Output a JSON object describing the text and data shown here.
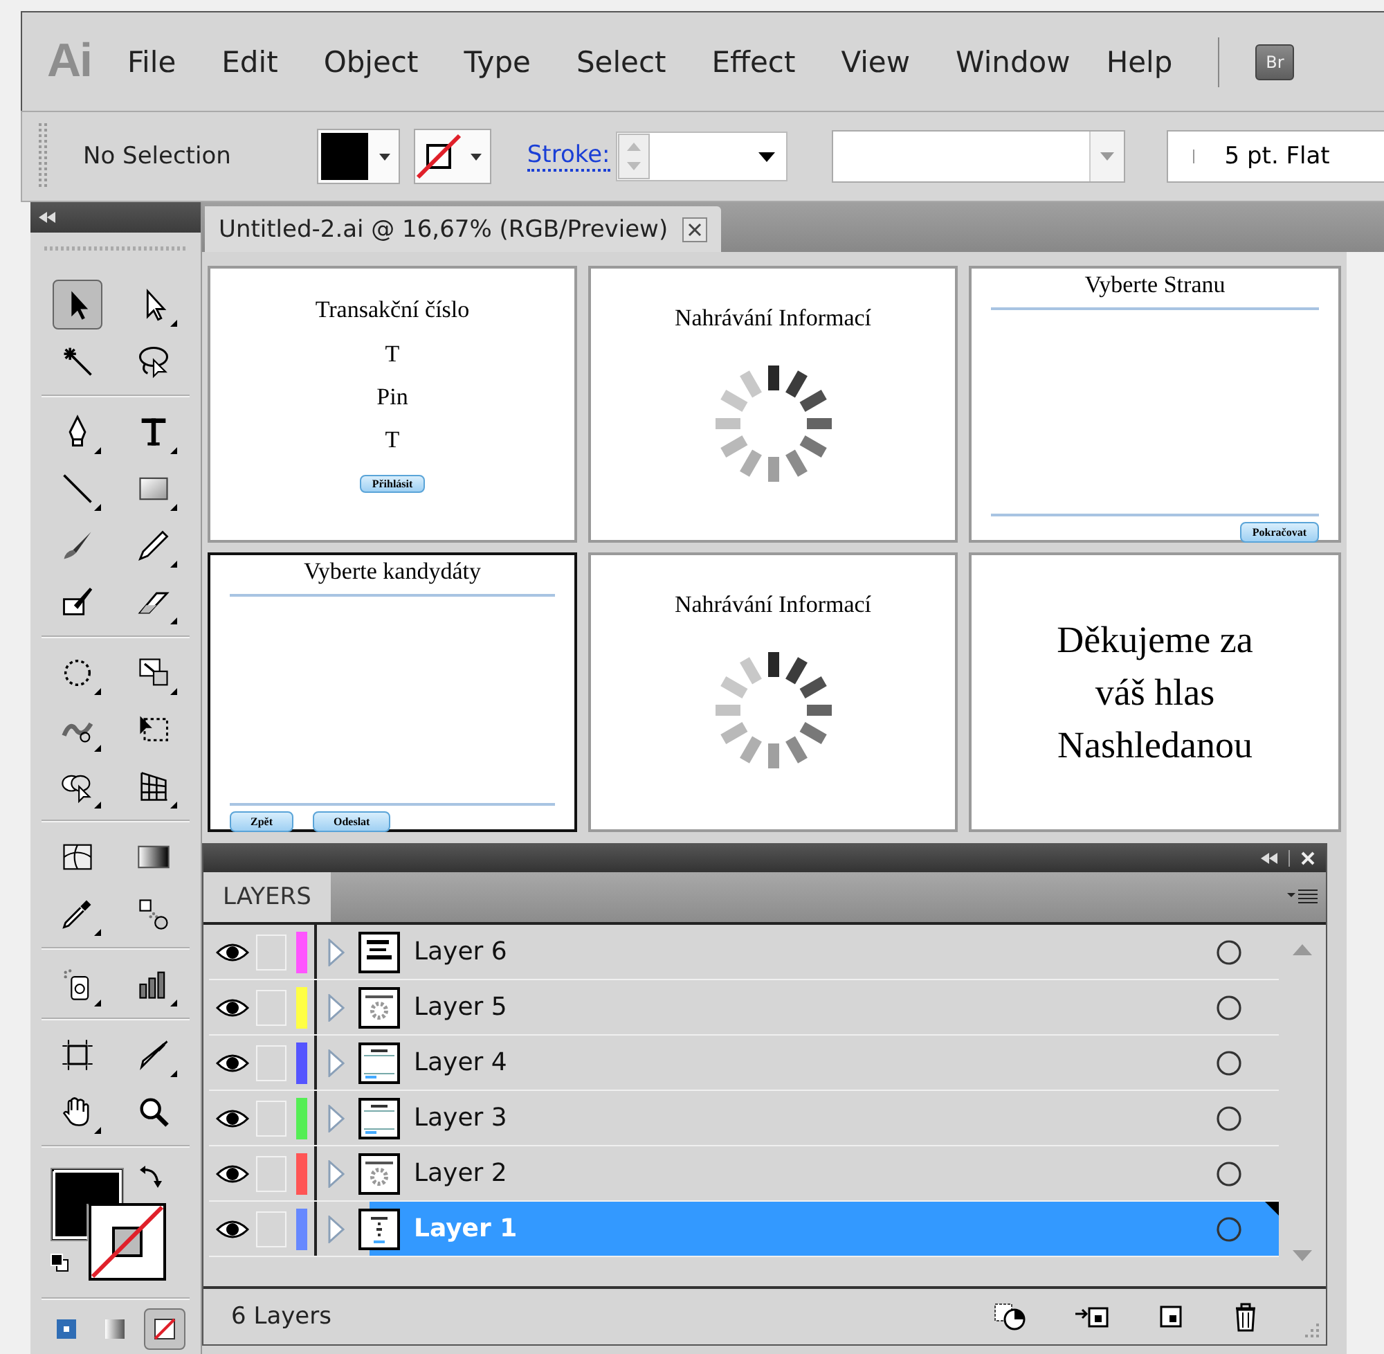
{
  "app": {
    "logo": "Ai",
    "bridge_button": "Br"
  },
  "menu": [
    "File",
    "Edit",
    "Object",
    "Type",
    "Select",
    "Effect",
    "View",
    "Window",
    "Help"
  ],
  "control_bar": {
    "selection": "No Selection",
    "stroke_label": "Stroke:",
    "stroke_style": "5 pt. Flat"
  },
  "document_tab": {
    "title": "Untitled-2.ai @ 16,67% (RGB/Preview)"
  },
  "tools": [
    {
      "kind": "selection",
      "selected": true,
      "flyout": false
    },
    {
      "kind": "direct-selection",
      "selected": false,
      "flyout": true
    },
    {
      "kind": "magic-wand",
      "selected": false,
      "flyout": false
    },
    {
      "kind": "lasso",
      "selected": false,
      "flyout": false
    },
    {
      "kind": "pen",
      "selected": false,
      "flyout": true
    },
    {
      "kind": "type",
      "selected": false,
      "flyout": true
    },
    {
      "kind": "line",
      "selected": false,
      "flyout": true
    },
    {
      "kind": "rectangle",
      "selected": false,
      "flyout": true
    },
    {
      "kind": "paintbrush",
      "selected": false,
      "flyout": false
    },
    {
      "kind": "pencil",
      "selected": false,
      "flyout": true
    },
    {
      "kind": "blob-brush",
      "selected": false,
      "flyout": false
    },
    {
      "kind": "eraser",
      "selected": false,
      "flyout": true
    },
    {
      "kind": "rotate",
      "selected": false,
      "flyout": true
    },
    {
      "kind": "scale",
      "selected": false,
      "flyout": true
    },
    {
      "kind": "warp",
      "selected": false,
      "flyout": true
    },
    {
      "kind": "free-transform",
      "selected": false,
      "flyout": false
    },
    {
      "kind": "shape-builder",
      "selected": false,
      "flyout": true
    },
    {
      "kind": "perspective-grid",
      "selected": false,
      "flyout": true
    },
    {
      "kind": "mesh",
      "selected": false,
      "flyout": false
    },
    {
      "kind": "gradient",
      "selected": false,
      "flyout": false
    },
    {
      "kind": "eyedropper",
      "selected": false,
      "flyout": true
    },
    {
      "kind": "blend",
      "selected": false,
      "flyout": false
    },
    {
      "kind": "symbol-sprayer",
      "selected": false,
      "flyout": true
    },
    {
      "kind": "column-graph",
      "selected": false,
      "flyout": true
    },
    {
      "kind": "artboard",
      "selected": false,
      "flyout": false
    },
    {
      "kind": "slice",
      "selected": false,
      "flyout": true
    },
    {
      "kind": "hand",
      "selected": false,
      "flyout": true
    },
    {
      "kind": "zoom",
      "selected": false,
      "flyout": false
    }
  ],
  "color_modes": [
    {
      "kind": "color",
      "selected": false
    },
    {
      "kind": "gradient",
      "selected": false
    },
    {
      "kind": "none",
      "selected": true
    }
  ],
  "artboards": [
    {
      "kind": "login",
      "selected": false,
      "title": "Transakční číslo",
      "lines": [
        "T",
        "Pin",
        "T"
      ],
      "buttons": [
        "Přihlásit"
      ]
    },
    {
      "kind": "loading",
      "selected": false,
      "title": "Nahrávání Informací"
    },
    {
      "kind": "list",
      "selected": false,
      "title": "Vyberte Stranu",
      "buttons": [
        "Pokračovat"
      ]
    },
    {
      "kind": "list",
      "selected": true,
      "title": "Vyberte kandydáty",
      "buttons": [
        "Zpět",
        "Odeslat"
      ]
    },
    {
      "kind": "loading",
      "selected": false,
      "title": "Nahrávání Informací"
    },
    {
      "kind": "message",
      "selected": false,
      "lines": [
        "Děkujeme za",
        "váš hlas",
        "Nashledanou"
      ]
    }
  ],
  "layers_panel": {
    "tab": "LAYERS",
    "footer": "6 Layers",
    "layers": [
      {
        "name": "Layer 6",
        "color": "#ff55ff",
        "visible": true,
        "selected": false
      },
      {
        "name": "Layer 5",
        "color": "#ffff44",
        "visible": true,
        "selected": false
      },
      {
        "name": "Layer 4",
        "color": "#5555ff",
        "visible": true,
        "selected": false
      },
      {
        "name": "Layer 3",
        "color": "#55ee55",
        "visible": true,
        "selected": false
      },
      {
        "name": "Layer 2",
        "color": "#ff5555",
        "visible": true,
        "selected": false
      },
      {
        "name": "Layer 1",
        "color": "#6688ff",
        "visible": true,
        "selected": true
      }
    ]
  }
}
